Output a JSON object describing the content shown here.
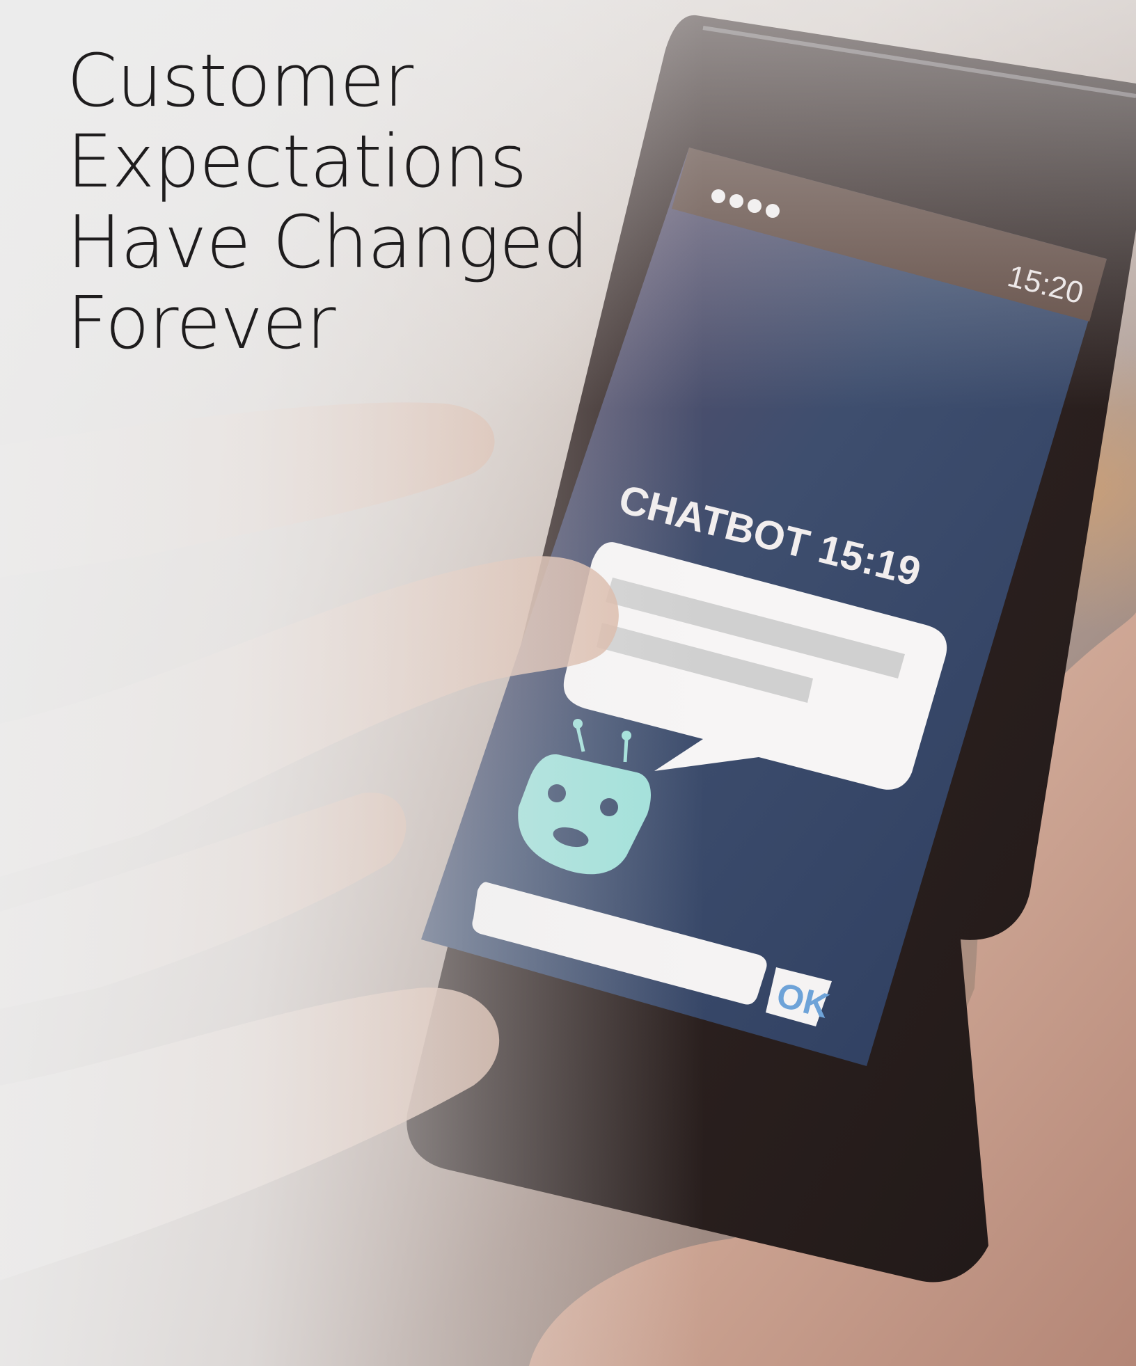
{
  "headline": {
    "lines": [
      "Customer",
      "Expectations",
      "Have Changed",
      "Forever"
    ]
  },
  "phone": {
    "status_time": "15:20",
    "signal_dots": 4,
    "chat_header": "CHATBOT 15:19",
    "ok_button_label": "OK"
  },
  "colors": {
    "screen_top": "#5e4a60",
    "screen_bottom": "#2d4a6c",
    "bubble": "#f7f5f5",
    "bubble_text_bar": "#cfcfcf",
    "robot": "#9fe0d9",
    "ok_text": "#6ea3d8"
  },
  "icons": [
    "robot-icon",
    "signal-dots-icon"
  ]
}
